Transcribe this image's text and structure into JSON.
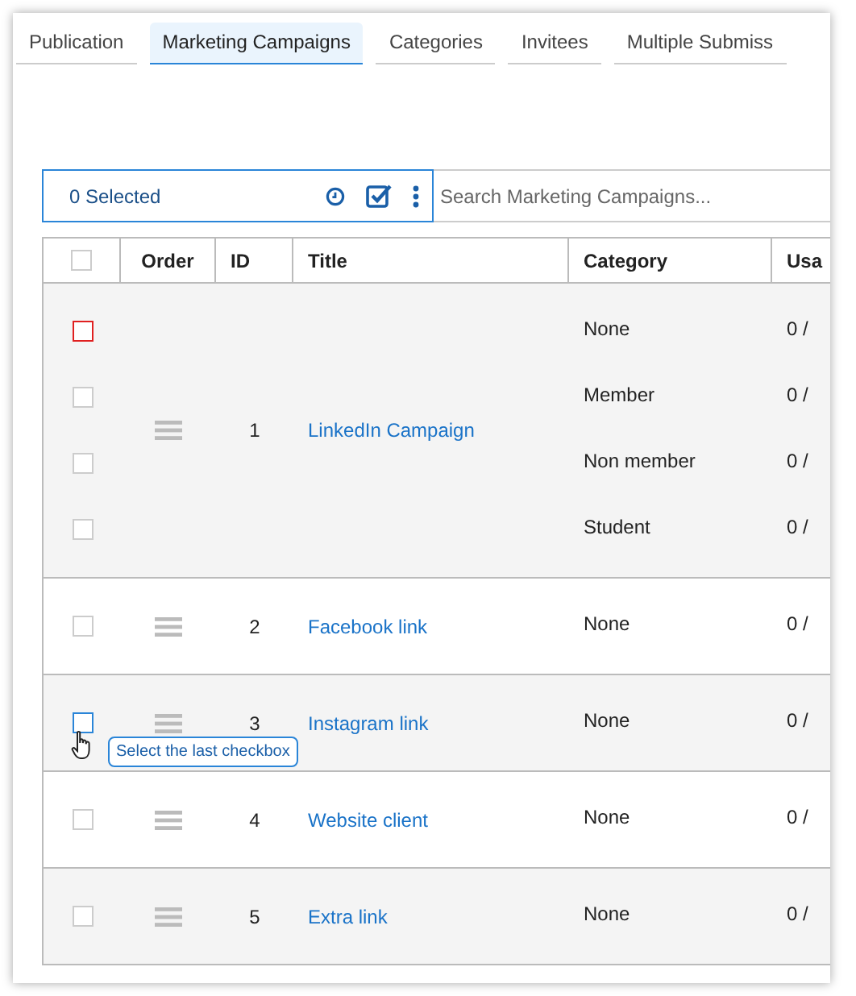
{
  "tabs": [
    {
      "label": "Publication",
      "selected": false
    },
    {
      "label": "Marketing Campaigns",
      "selected": true
    },
    {
      "label": "Categories",
      "selected": false
    },
    {
      "label": "Invitees",
      "selected": false
    },
    {
      "label": "Multiple Submiss",
      "selected": false
    }
  ],
  "toolbar": {
    "selected_count": "0 Selected",
    "search": {
      "placeholder": "Search Marketing Campaigns..."
    }
  },
  "table": {
    "select_all": {
      "checked": false
    },
    "columns": [
      "Order",
      "ID",
      "Title",
      "Category",
      "Usa"
    ],
    "rows": [
      {
        "id": "1",
        "title": "LinkedIn Campaign",
        "entries": [
          {
            "category": "None",
            "usage": "0 /",
            "checked": false,
            "color": "#e02020"
          },
          {
            "category": "Member",
            "usage": "0 /",
            "checked": false,
            "color": "#cccccc"
          },
          {
            "category": "Non member",
            "usage": "0 /",
            "checked": false,
            "color": "#cccccc"
          },
          {
            "category": "Student",
            "usage": "0 /",
            "checked": false,
            "color": "#cccccc"
          }
        ]
      },
      {
        "id": "2",
        "title": "Facebook link",
        "entries": [
          {
            "category": "None",
            "usage": "0 /",
            "checked": false,
            "color": "#cccccc"
          }
        ]
      },
      {
        "id": "3",
        "title": "Instagram link",
        "entries": [
          {
            "category": "None",
            "usage": "0 /",
            "checked": false,
            "color": "#2a85d8",
            "tooltip": "Select the last checkbox"
          }
        ]
      },
      {
        "id": "4",
        "title": "Website client",
        "entries": [
          {
            "category": "None",
            "usage": "0 /",
            "checked": false,
            "color": "#cccccc"
          }
        ]
      },
      {
        "id": "5",
        "title": "Extra link",
        "entries": [
          {
            "category": "None",
            "usage": "0 /",
            "checked": false,
            "color": "#cccccc"
          }
        ]
      }
    ]
  }
}
